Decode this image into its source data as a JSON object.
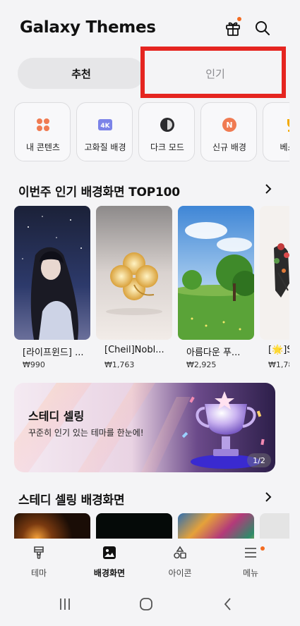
{
  "app": {
    "title": "Galaxy Themes"
  },
  "header": {
    "icons": [
      "gift-icon",
      "search-icon"
    ],
    "notification_color": "#f36b21"
  },
  "tabs": [
    {
      "label": "추천",
      "selected": true
    },
    {
      "label": "인기",
      "selected": false
    }
  ],
  "categories": [
    {
      "label": "내 콘텐츠",
      "icon": "my-content-icon"
    },
    {
      "label": "고화질 배경",
      "icon": "4k-icon",
      "badge": "4K"
    },
    {
      "label": "다크 모드",
      "icon": "dark-mode-icon"
    },
    {
      "label": "신규 배경",
      "icon": "new-icon",
      "badge": "N"
    },
    {
      "label": "베스트",
      "icon": "trophy-icon"
    }
  ],
  "section_top100": {
    "title": "이번주 인기 배경화면 TOP100",
    "items": [
      {
        "name": "[라이프윈드] ...",
        "price": "₩990"
      },
      {
        "name": "[Cheil]Nobl...",
        "price": "₩1,763"
      },
      {
        "name": "아름다운 푸...",
        "price": "₩2,925"
      },
      {
        "name": "[🌟]S",
        "price": "₩1,78"
      }
    ]
  },
  "banner": {
    "title": "스테디 셀링",
    "subtitle": "꾸준히 인기 있는 테마를 한눈에!",
    "page": "1/2"
  },
  "section_steady": {
    "title": "스테디 셀링 배경화면"
  },
  "bottom_nav": [
    {
      "label": "테마",
      "icon": "theme-brush-icon",
      "active": false
    },
    {
      "label": "배경화면",
      "icon": "wallpaper-icon",
      "active": true
    },
    {
      "label": "아이콘",
      "icon": "shapes-icon",
      "active": false
    },
    {
      "label": "메뉴",
      "icon": "menu-icon",
      "active": false
    }
  ],
  "system_nav": [
    "recents-button",
    "home-button",
    "back-button"
  ],
  "colors": {
    "accent": "#f36b21",
    "highlight": "#e52520",
    "background": "#f4f4f6"
  }
}
